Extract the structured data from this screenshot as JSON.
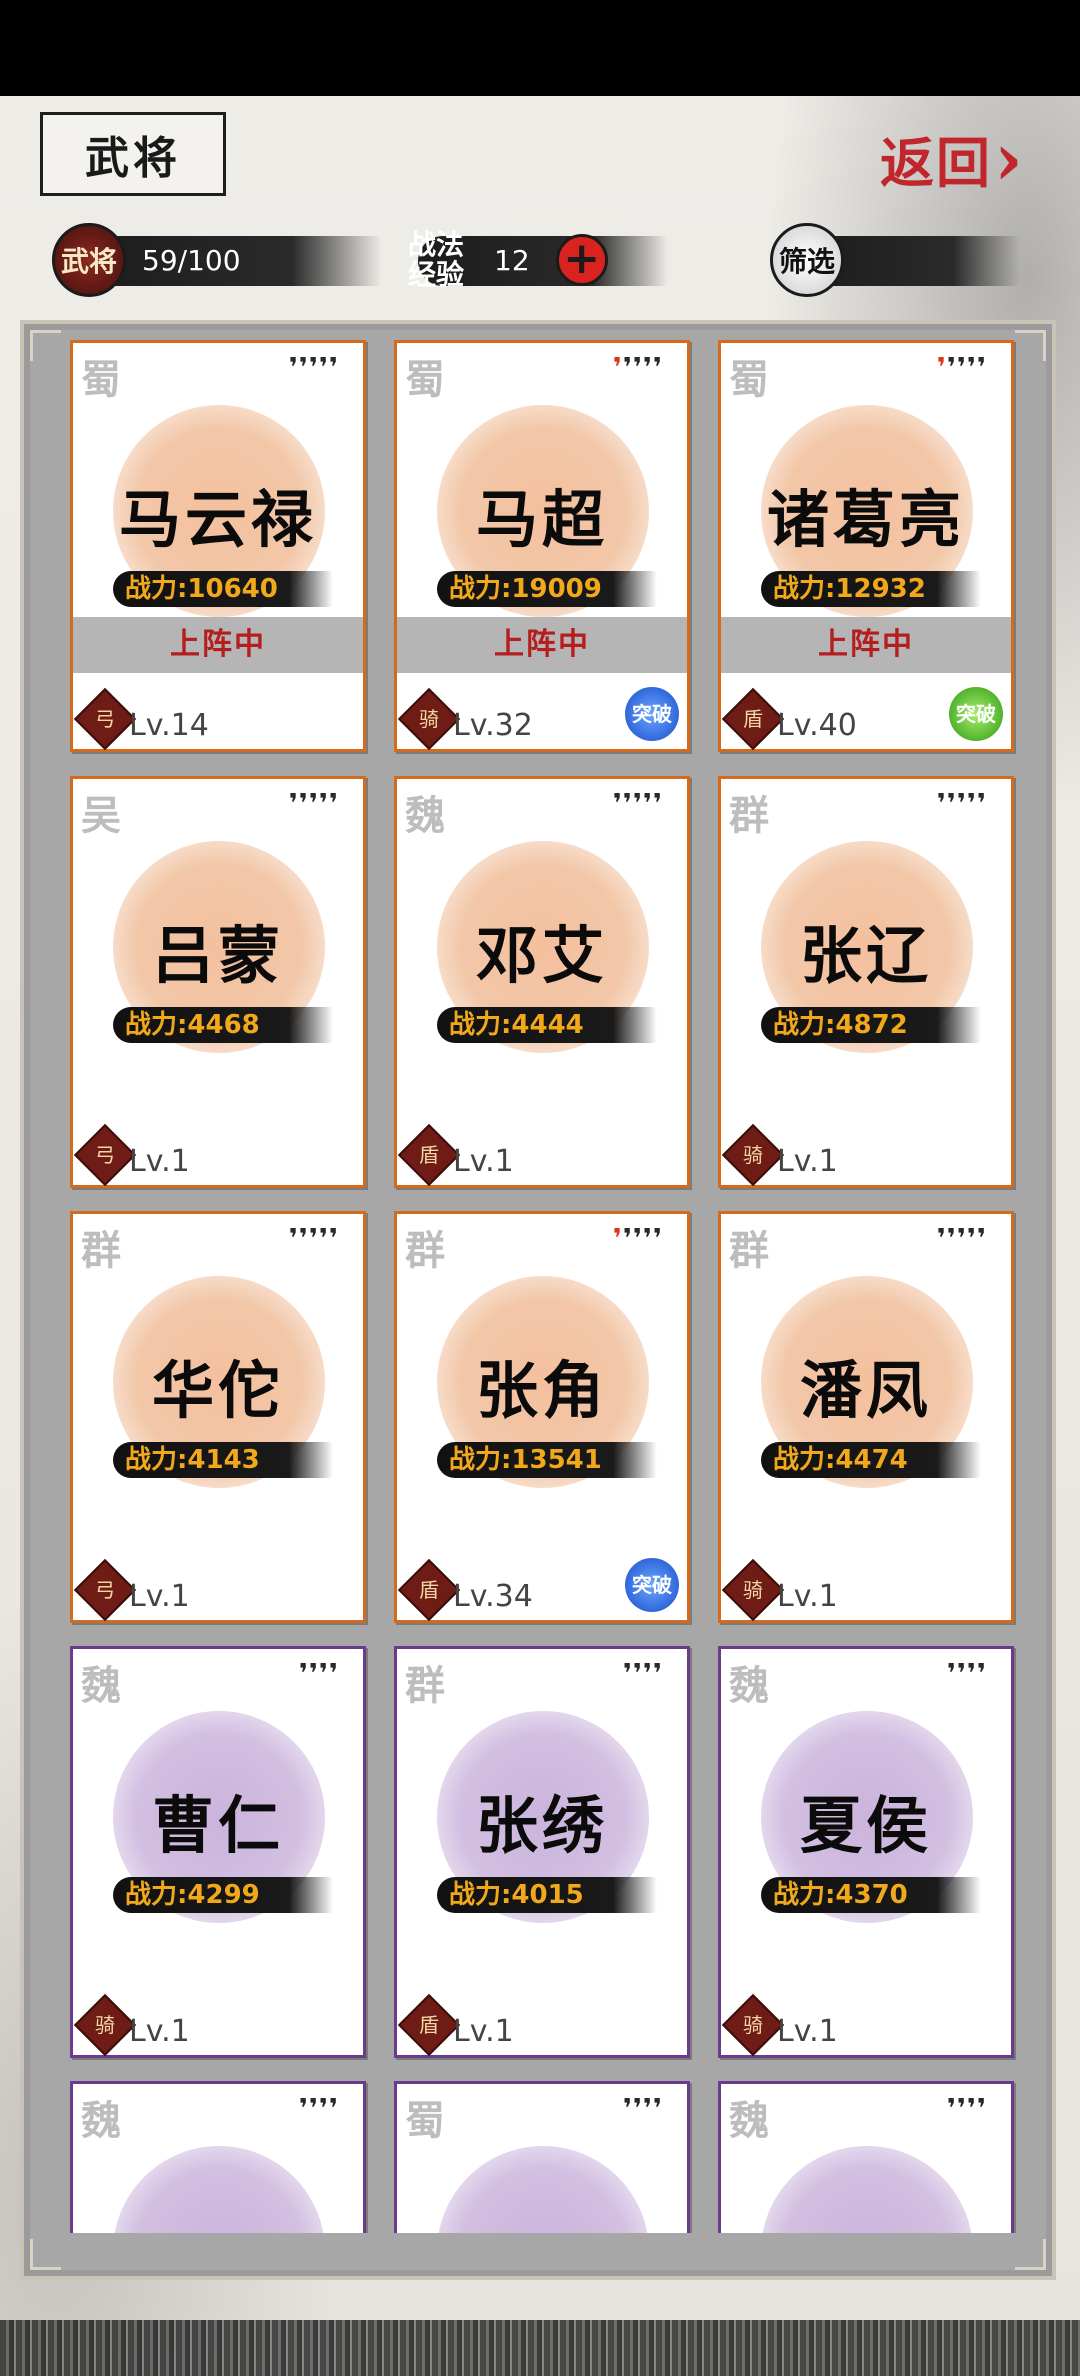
{
  "header": {
    "title": "武将",
    "back_label": "返回"
  },
  "stats": {
    "generals_badge": "武将",
    "generals_count": "59/100",
    "exp_label_line1": "战法",
    "exp_label_line2": "经验",
    "exp_value": "12",
    "plus_symbol": "+",
    "filter_label": "筛选"
  },
  "colors": {
    "orange_border": "#d36a1e",
    "purple_border": "#6a3a8c",
    "power_text": "#f2a81b",
    "deploy_text": "#b41e1e",
    "back_text": "#c0272d"
  },
  "cards": [
    {
      "faction": "蜀",
      "stars_hl": "",
      "stars": "❜❜❜❜❜",
      "name": "马云禄",
      "power": "战力:10640",
      "deploy": "上阵中",
      "role": "弓",
      "level": "Lv.14",
      "badge": "",
      "color": "orange"
    },
    {
      "faction": "蜀",
      "stars_hl": "❜",
      "stars": "❜❜❜❜",
      "name": "马超",
      "power": "战力:19009",
      "deploy": "上阵中",
      "role": "骑",
      "level": "Lv.32",
      "badge": "突破",
      "badge_color": "blue",
      "color": "orange"
    },
    {
      "faction": "蜀",
      "stars_hl": "❜",
      "stars": "❜❜❜❜",
      "name": "诸葛亮",
      "power": "战力:12932",
      "deploy": "上阵中",
      "role": "盾",
      "level": "Lv.40",
      "badge": "突破",
      "badge_color": "green",
      "color": "orange"
    },
    {
      "faction": "吴",
      "stars_hl": "",
      "stars": "❜❜❜❜❜",
      "name": "吕蒙",
      "power": "战力:4468",
      "deploy": "",
      "role": "弓",
      "level": "Lv.1",
      "badge": "",
      "color": "orange"
    },
    {
      "faction": "魏",
      "stars_hl": "",
      "stars": "❜❜❜❜❜",
      "name": "邓艾",
      "power": "战力:4444",
      "deploy": "",
      "role": "盾",
      "level": "Lv.1",
      "badge": "",
      "color": "orange"
    },
    {
      "faction": "群",
      "stars_hl": "",
      "stars": "❜❜❜❜❜",
      "name": "张辽",
      "power": "战力:4872",
      "deploy": "",
      "role": "骑",
      "level": "Lv.1",
      "badge": "",
      "color": "orange"
    },
    {
      "faction": "群",
      "stars_hl": "",
      "stars": "❜❜❜❜❜",
      "name": "华佗",
      "power": "战力:4143",
      "deploy": "",
      "role": "弓",
      "level": "Lv.1",
      "badge": "",
      "color": "orange"
    },
    {
      "faction": "群",
      "stars_hl": "❜",
      "stars": "❜❜❜❜",
      "name": "张角",
      "power": "战力:13541",
      "deploy": "",
      "role": "盾",
      "level": "Lv.34",
      "badge": "突破",
      "badge_color": "blue",
      "color": "orange"
    },
    {
      "faction": "群",
      "stars_hl": "",
      "stars": "❜❜❜❜❜",
      "name": "潘凤",
      "power": "战力:4474",
      "deploy": "",
      "role": "骑",
      "level": "Lv.1",
      "badge": "",
      "color": "orange"
    },
    {
      "faction": "魏",
      "stars_hl": "",
      "stars": "❜❜❜❜",
      "name": "曹仁",
      "power": "战力:4299",
      "deploy": "",
      "role": "骑",
      "level": "Lv.1",
      "badge": "",
      "color": "purple"
    },
    {
      "faction": "群",
      "stars_hl": "",
      "stars": "❜❜❜❜",
      "name": "张绣",
      "power": "战力:4015",
      "deploy": "",
      "role": "盾",
      "level": "Lv.1",
      "badge": "",
      "color": "purple"
    },
    {
      "faction": "魏",
      "stars_hl": "",
      "stars": "❜❜❜❜",
      "name": "夏侯",
      "power": "战力:4370",
      "deploy": "",
      "role": "骑",
      "level": "Lv.1",
      "badge": "",
      "color": "purple"
    },
    {
      "faction": "魏",
      "stars_hl": "",
      "stars": "❜❜❜❜",
      "name": "",
      "power": "",
      "deploy": "",
      "role": "",
      "level": "",
      "badge": "",
      "color": "purple"
    },
    {
      "faction": "蜀",
      "stars_hl": "",
      "stars": "❜❜❜❜",
      "name": "",
      "power": "",
      "deploy": "",
      "role": "",
      "level": "",
      "badge": "",
      "color": "purple"
    },
    {
      "faction": "魏",
      "stars_hl": "",
      "stars": "❜❜❜❜",
      "name": "",
      "power": "",
      "deploy": "",
      "role": "",
      "level": "",
      "badge": "",
      "color": "purple"
    }
  ]
}
